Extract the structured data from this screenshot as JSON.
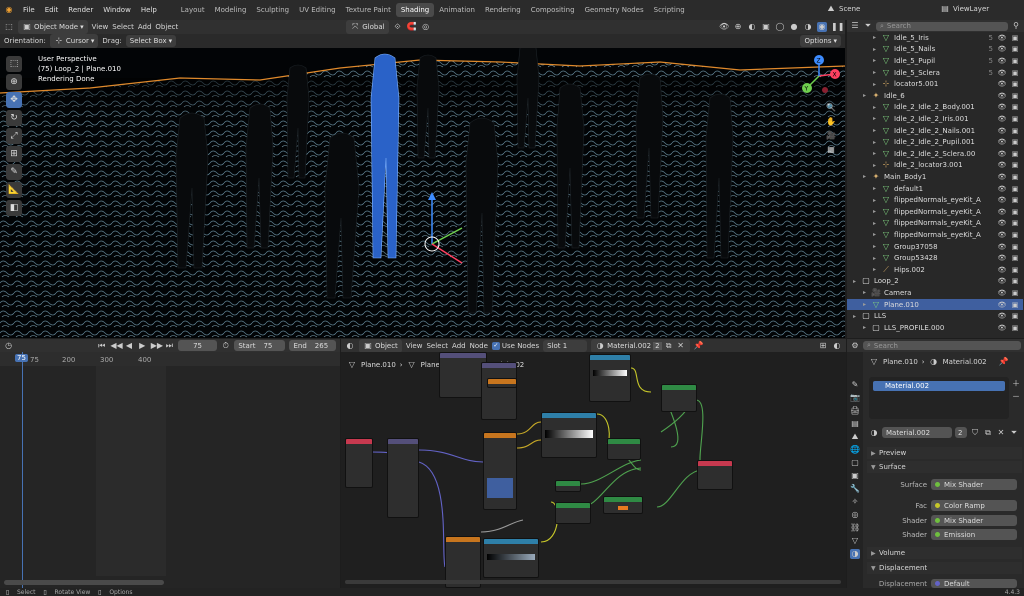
{
  "topbar": {
    "menus": [
      "File",
      "Edit",
      "Render",
      "Window",
      "Help"
    ],
    "workspaces": [
      "Layout",
      "Modeling",
      "Sculpting",
      "UV Editing",
      "Texture Paint",
      "Shading",
      "Animation",
      "Rendering",
      "Compositing",
      "Geometry Nodes",
      "Scripting"
    ],
    "active_workspace": "Shading",
    "scene": "Scene",
    "view_layer": "ViewLayer"
  },
  "viewport": {
    "mode": "Object Mode",
    "menus": [
      "View",
      "Select",
      "Add",
      "Object"
    ],
    "transform": "Global",
    "orientation_label": "Orientation:",
    "orientation_value": "Cursor",
    "drag_label": "Drag:",
    "drag_value": "Select Box",
    "options": "Options",
    "info_line1": "User Perspective",
    "info_line2": "(75) Loop_2 | Plane.010",
    "info_line3": "Rendering Done",
    "gizmo": {
      "x": "X",
      "y": "Y",
      "z": "Z"
    }
  },
  "outliner": {
    "search_placeholder": "Search",
    "rows": [
      {
        "label": "Idle_5_Iris",
        "indent": 2,
        "icon": "mesh",
        "sel": false,
        "extra": "5"
      },
      {
        "label": "Idle_5_Nails",
        "indent": 2,
        "icon": "mesh",
        "sel": false,
        "extra": "5"
      },
      {
        "label": "Idle_5_Pupil",
        "indent": 2,
        "icon": "mesh",
        "sel": false,
        "extra": "5"
      },
      {
        "label": "Idle_5_Sclera",
        "indent": 2,
        "icon": "mesh",
        "sel": false,
        "extra": "5"
      },
      {
        "label": "locator5.001",
        "indent": 2,
        "icon": "empty",
        "sel": false,
        "extra": ""
      },
      {
        "label": "Idle_6",
        "indent": 1,
        "icon": "armature",
        "sel": false,
        "extra": ""
      },
      {
        "label": "Idle_2_Idle_2_Body.001",
        "indent": 2,
        "icon": "mesh",
        "sel": false,
        "extra": ""
      },
      {
        "label": "Idle_2_Idle_2_Iris.001",
        "indent": 2,
        "icon": "mesh",
        "sel": false,
        "extra": ""
      },
      {
        "label": "Idle_2_Idle_2_Nails.001",
        "indent": 2,
        "icon": "mesh",
        "sel": false,
        "extra": ""
      },
      {
        "label": "Idle_2_Idle_2_Pupil.001",
        "indent": 2,
        "icon": "mesh",
        "sel": false,
        "extra": ""
      },
      {
        "label": "Idle_2_Idle_2_Sclera.00",
        "indent": 2,
        "icon": "mesh",
        "sel": false,
        "extra": ""
      },
      {
        "label": "Idle_2_locator3.001",
        "indent": 2,
        "icon": "empty",
        "sel": false,
        "extra": ""
      },
      {
        "label": "Main_Body1",
        "indent": 1,
        "icon": "armature",
        "sel": false,
        "extra": ""
      },
      {
        "label": "default1",
        "indent": 2,
        "icon": "mesh",
        "sel": false,
        "extra": ""
      },
      {
        "label": "flippedNormals_eyeKit_A",
        "indent": 2,
        "icon": "mesh",
        "sel": false,
        "extra": ""
      },
      {
        "label": "flippedNormals_eyeKit_A",
        "indent": 2,
        "icon": "mesh",
        "sel": false,
        "extra": ""
      },
      {
        "label": "flippedNormals_eyeKit_A",
        "indent": 2,
        "icon": "mesh",
        "sel": false,
        "extra": ""
      },
      {
        "label": "flippedNormals_eyeKit_A",
        "indent": 2,
        "icon": "mesh",
        "sel": false,
        "extra": ""
      },
      {
        "label": "Group37058",
        "indent": 2,
        "icon": "mesh",
        "sel": false,
        "extra": ""
      },
      {
        "label": "Group53428",
        "indent": 2,
        "icon": "mesh",
        "sel": false,
        "extra": ""
      },
      {
        "label": "Hips.002",
        "indent": 2,
        "icon": "bone",
        "sel": false,
        "extra": ""
      },
      {
        "label": "Loop_2",
        "indent": 0,
        "icon": "collection",
        "sel": false,
        "extra": ""
      },
      {
        "label": "Camera",
        "indent": 1,
        "icon": "camera",
        "sel": false,
        "extra": ""
      },
      {
        "label": "Plane.010",
        "indent": 1,
        "icon": "mesh",
        "sel": true,
        "extra": ""
      },
      {
        "label": "LLS",
        "indent": 0,
        "icon": "collection",
        "sel": false,
        "extra": ""
      },
      {
        "label": "LLS_PROFILE.000",
        "indent": 1,
        "icon": "collection",
        "sel": false,
        "extra": ""
      }
    ]
  },
  "timeline": {
    "frame": "75",
    "start_label": "Start",
    "start": "75",
    "end_label": "End",
    "end": "265",
    "ticks": [
      "75",
      "200",
      "300",
      "400"
    ],
    "playhead_label": "75"
  },
  "node_editor": {
    "type": "Object",
    "menus": [
      "View",
      "Select",
      "Add",
      "Node"
    ],
    "use_nodes": "Use Nodes",
    "slot": "Slot 1",
    "material": "Material.002",
    "users": "2",
    "breadcrumb": [
      "Plane.010",
      "Plane.013",
      "Material.002"
    ]
  },
  "properties": {
    "search_placeholder": "Search",
    "object": "Plane.010",
    "material": "Material.002",
    "slot_item": "Material.002",
    "mat_field": "Material.002",
    "mat_users": "2",
    "sections": {
      "preview": "Preview",
      "surface": "Surface",
      "volume": "Volume",
      "displacement": "Displacement"
    },
    "surface": [
      {
        "label": "Surface",
        "value": "Mix Shader"
      },
      {
        "label": "Fac",
        "value": "Color Ramp"
      },
      {
        "label": "Shader",
        "value": "Mix Shader"
      },
      {
        "label": "Shader",
        "value": "Emission"
      }
    ],
    "displacement_row": {
      "label": "Displacement",
      "value": "Default"
    }
  },
  "statusbar": {
    "select": "Select",
    "rotate": "Rotate View",
    "options": "Options",
    "version": "4.4.3"
  },
  "colors": {
    "accent": "#4772b3",
    "select": "#3f5f9f",
    "active_ws": "#4a4a4a"
  }
}
